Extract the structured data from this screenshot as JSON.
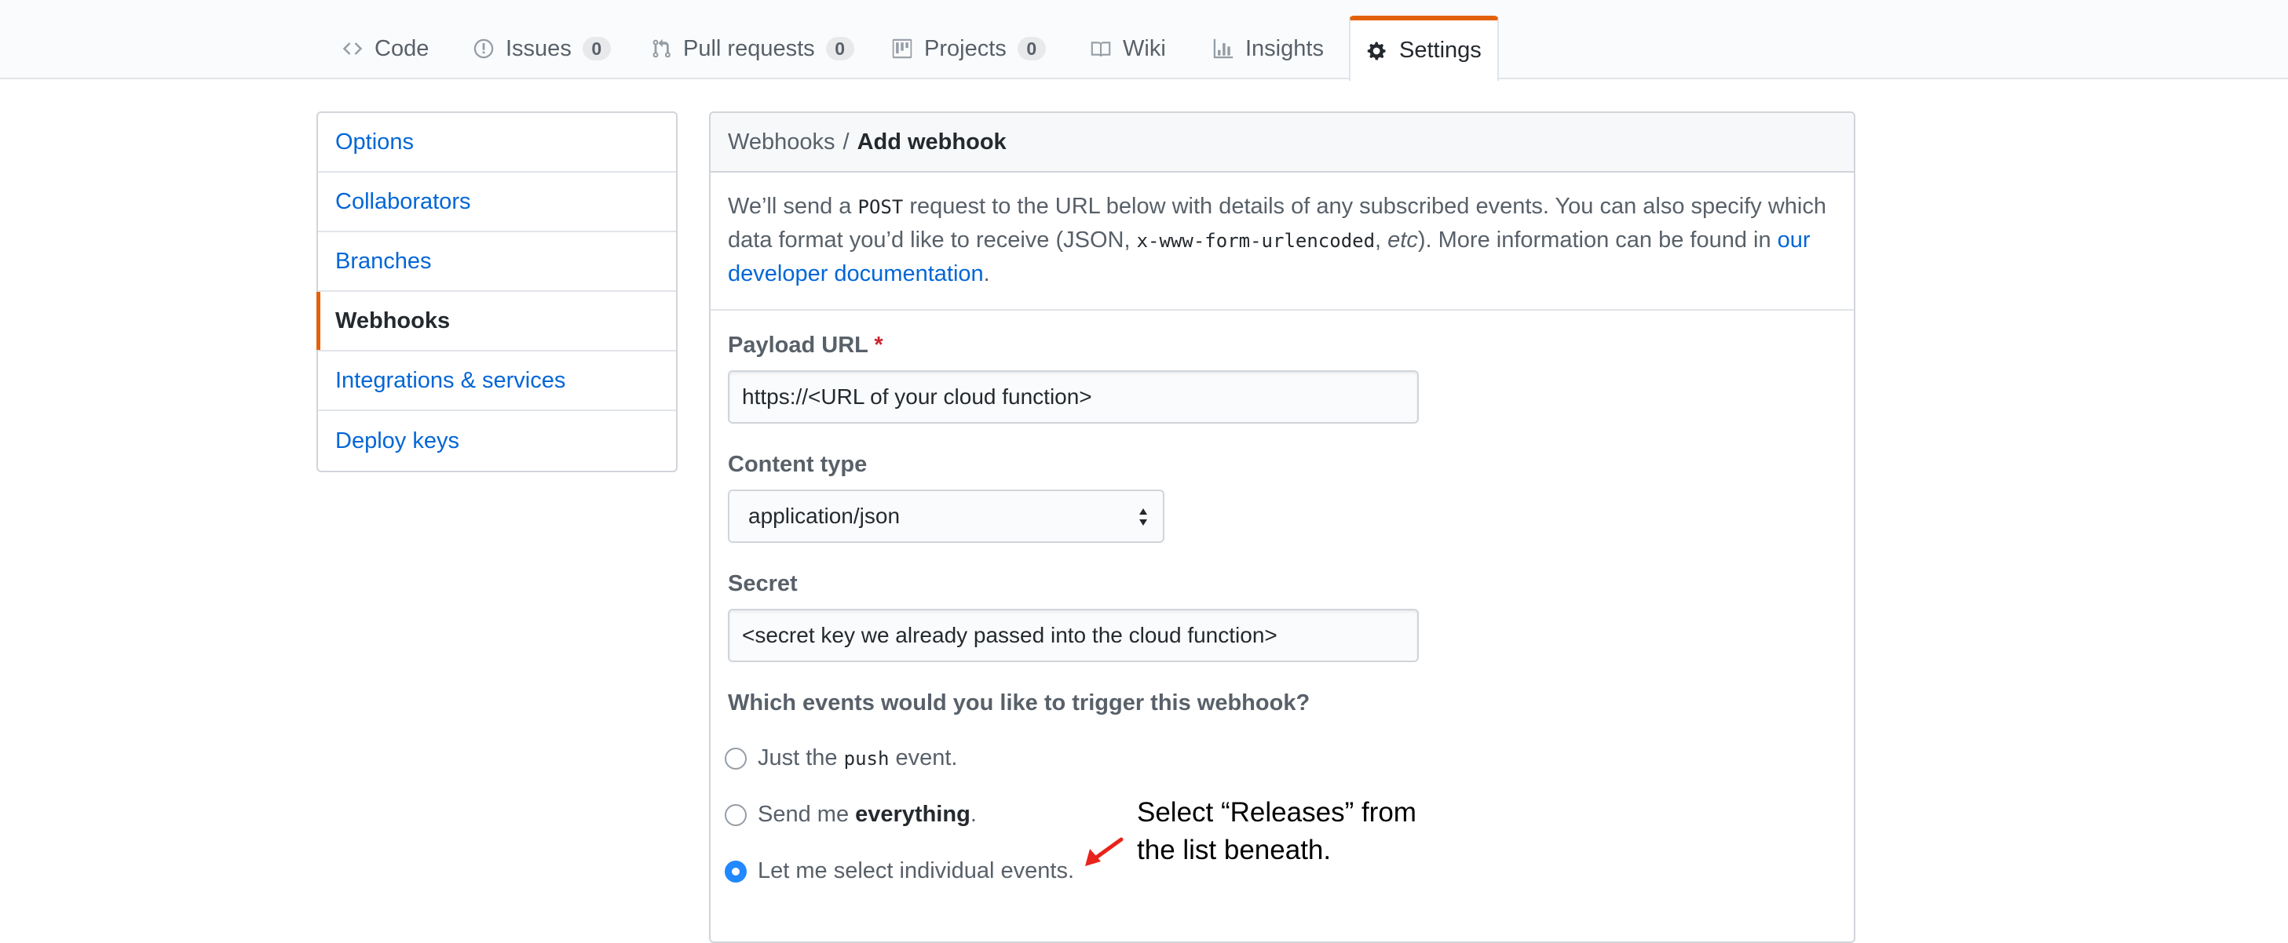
{
  "nav": {
    "tabs": [
      {
        "label": "Code",
        "icon": "code-icon",
        "count": null
      },
      {
        "label": "Issues",
        "icon": "issue-icon",
        "count": "0"
      },
      {
        "label": "Pull requests",
        "icon": "pull-request-icon",
        "count": "0"
      },
      {
        "label": "Projects",
        "icon": "project-icon",
        "count": "0"
      },
      {
        "label": "Wiki",
        "icon": "book-icon",
        "count": null
      },
      {
        "label": "Insights",
        "icon": "graph-icon",
        "count": null
      },
      {
        "label": "Settings",
        "icon": "gear-icon",
        "count": null,
        "selected": true
      }
    ]
  },
  "menu": {
    "items": [
      {
        "label": "Options"
      },
      {
        "label": "Collaborators"
      },
      {
        "label": "Branches"
      },
      {
        "label": "Webhooks",
        "selected": true
      },
      {
        "label": "Integrations & services"
      },
      {
        "label": "Deploy keys"
      }
    ]
  },
  "panel": {
    "breadcrumb_parent": "Webhooks",
    "breadcrumb_sep": "/",
    "breadcrumb_current": "Add webhook",
    "intro": {
      "part1": "We’ll send a ",
      "post": "POST",
      "part2": " request to the URL below with details of any subscribed events. You can also specify which data format you’d like to receive (JSON, ",
      "urlencoded": "x-www-form-urlencoded",
      "part3": ", ",
      "etc": "etc",
      "part4": "). More information can be found in ",
      "link": "our developer documentation",
      "part5": "."
    },
    "payload_url": {
      "label": "Payload URL",
      "required_mark": "*",
      "value": "https://<URL of your cloud function>"
    },
    "content_type": {
      "label": "Content type",
      "value": "application/json"
    },
    "secret": {
      "label": "Secret",
      "value": "<secret key we already passed into the cloud function>"
    },
    "events": {
      "question": "Which events would you like to trigger this webhook?",
      "options": [
        {
          "pre": "Just the ",
          "mono": "push",
          "post": " event.",
          "checked": false
        },
        {
          "pre": "Send me ",
          "bold": "everything",
          "post": ".",
          "checked": false
        },
        {
          "pre": "Let me select individual events.",
          "checked": true
        }
      ]
    }
  },
  "annotation": {
    "line1": "Select “Releases” from",
    "line2": "the list beneath.",
    "arrow_color": "#e8231b"
  },
  "colors": {
    "accent_orange": "#e36209",
    "link_blue": "#0366d6",
    "radio_blue": "#2188ff",
    "required_red": "#cb2431"
  }
}
